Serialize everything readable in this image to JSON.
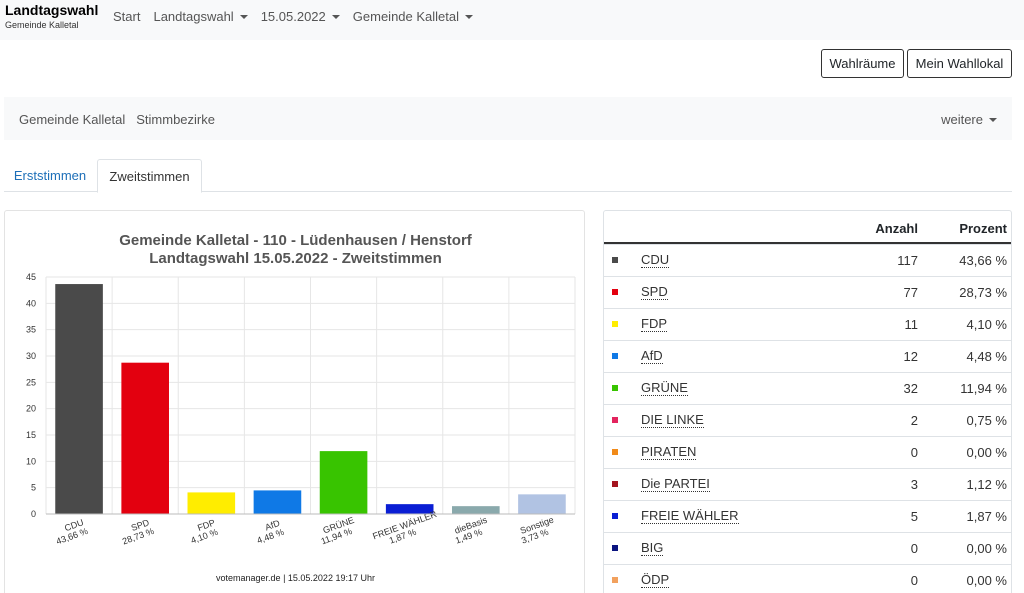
{
  "navbar": {
    "brand_title": "Landtagswahl",
    "brand_subtitle": "Gemeinde Kalletal",
    "items": [
      {
        "label": "Start",
        "dropdown": false
      },
      {
        "label": "Landtagswahl",
        "dropdown": true
      },
      {
        "label": "15.05.2022",
        "dropdown": true
      },
      {
        "label": "Gemeinde Kalletal",
        "dropdown": true
      }
    ]
  },
  "buttons": {
    "wahlraeume": "Wahlräume",
    "mein_wahllokal": "Mein Wahllokal"
  },
  "subnav": {
    "items": [
      "Gemeinde Kalletal",
      "Stimmbezirke"
    ],
    "more": "weitere"
  },
  "tabs": [
    {
      "label": "Erststimmen",
      "active": false
    },
    {
      "label": "Zweitstimmen",
      "active": true
    }
  ],
  "chart": {
    "title_line1": "Gemeinde Kalletal - 110 - Lüdenhausen / Henstorf",
    "title_line2": "Landtagswahl 15.05.2022  - Zweitstimmen",
    "credit": "votemanager.de | 15.05.2022 19:17 Uhr"
  },
  "chart_data": {
    "type": "bar",
    "title": "Gemeinde Kalletal - 110 - Lüdenhausen / Henstorf — Landtagswahl 15.05.2022  - Zweitstimmen",
    "categories": [
      "CDU",
      "SPD",
      "FDP",
      "AfD",
      "GRÜNE",
      "FREIE WÄHLER",
      "dieBasis",
      "Sonstige"
    ],
    "value_labels": [
      "43,66 %",
      "28,73 %",
      "4,10 %",
      "4,48 %",
      "11,94 %",
      "1,87 %",
      "1,49 %",
      "3,73 %"
    ],
    "values": [
      43.66,
      28.73,
      4.1,
      4.48,
      11.94,
      1.87,
      1.49,
      3.73
    ],
    "colors": [
      "#4a4a4a",
      "#e3000f",
      "#ffed00",
      "#0f79e6",
      "#38c400",
      "#0a1ed4",
      "#8aa9ac",
      "#b1c3e3"
    ],
    "ylim": [
      0,
      45
    ],
    "yticks": [
      0,
      5,
      10,
      15,
      20,
      25,
      30,
      35,
      40,
      45
    ],
    "grid": true
  },
  "table": {
    "col_anzahl": "Anzahl",
    "col_prozent": "Prozent",
    "rows": [
      {
        "party": "CDU",
        "anzahl": "117",
        "prozent": "43,66 %",
        "color": "#4a4a4a"
      },
      {
        "party": "SPD",
        "anzahl": "77",
        "prozent": "28,73 %",
        "color": "#e3000f"
      },
      {
        "party": "FDP",
        "anzahl": "11",
        "prozent": "4,10 %",
        "color": "#ffed00"
      },
      {
        "party": "AfD",
        "anzahl": "12",
        "prozent": "4,48 %",
        "color": "#0f79e6"
      },
      {
        "party": "GRÜNE",
        "anzahl": "32",
        "prozent": "11,94 %",
        "color": "#38c400"
      },
      {
        "party": "DIE LINKE",
        "anzahl": "2",
        "prozent": "0,75 %",
        "color": "#e3245e"
      },
      {
        "party": "PIRATEN",
        "anzahl": "0",
        "prozent": "0,00 %",
        "color": "#f18a18"
      },
      {
        "party": "Die PARTEI",
        "anzahl": "3",
        "prozent": "1,12 %",
        "color": "#a4141e"
      },
      {
        "party": "FREIE WÄHLER",
        "anzahl": "5",
        "prozent": "1,87 %",
        "color": "#0a1ed4"
      },
      {
        "party": "BIG",
        "anzahl": "0",
        "prozent": "0,00 %",
        "color": "#0a1480"
      },
      {
        "party": "ÖDP",
        "anzahl": "0",
        "prozent": "0,00 %",
        "color": "#f2a15e"
      }
    ]
  }
}
